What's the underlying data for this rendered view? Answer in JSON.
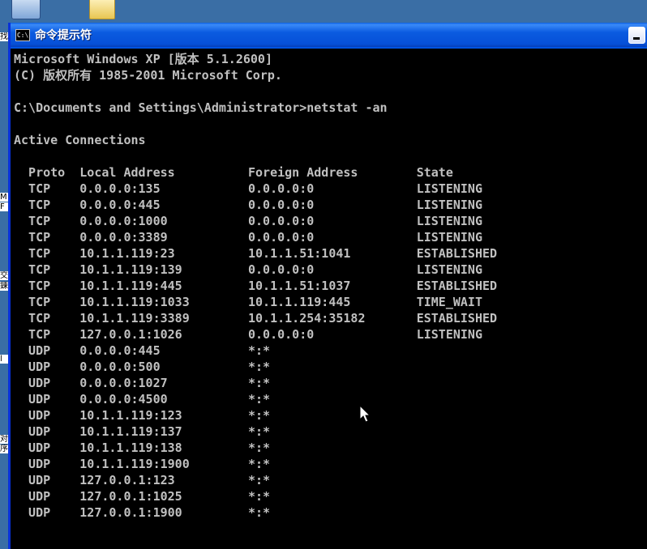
{
  "window": {
    "title": "命令提示符",
    "icon_text": "C:\\"
  },
  "console": {
    "lines": [
      "Microsoft Windows XP [版本 5.1.2600]",
      "(C) 版权所有 1985-2001 Microsoft Corp.",
      "",
      "C:\\Documents and Settings\\Administrator>netstat -an",
      "",
      "Active Connections",
      "",
      "  Proto  Local Address          Foreign Address        State",
      "  TCP    0.0.0.0:135            0.0.0.0:0              LISTENING",
      "  TCP    0.0.0.0:445            0.0.0.0:0              LISTENING",
      "  TCP    0.0.0.0:1000           0.0.0.0:0              LISTENING",
      "  TCP    0.0.0.0:3389           0.0.0.0:0              LISTENING",
      "  TCP    10.1.1.119:23          10.1.1.51:1041         ESTABLISHED",
      "  TCP    10.1.1.119:139         0.0.0.0:0              LISTENING",
      "  TCP    10.1.1.119:445         10.1.1.51:1037         ESTABLISHED",
      "  TCP    10.1.1.119:1033        10.1.1.119:445         TIME_WAIT",
      "  TCP    10.1.1.119:3389        10.1.1.254:35182       ESTABLISHED",
      "  TCP    127.0.0.1:1026         0.0.0.0:0              LISTENING",
      "  UDP    0.0.0.0:445            *:*",
      "  UDP    0.0.0.0:500            *:*",
      "  UDP    0.0.0.0:1027           *:*",
      "  UDP    0.0.0.0:4500           *:*",
      "  UDP    10.1.1.119:123         *:*",
      "  UDP    10.1.1.119:137         *:*",
      "  UDP    10.1.1.119:138         *:*",
      "  UDP    10.1.1.119:1900        *:*",
      "  UDP    127.0.0.1:123          *:*",
      "  UDP    127.0.0.1:1025         *:*",
      "  UDP    127.0.0.1:1900         *:*"
    ]
  },
  "desktop_left_glyphs": [
    "找",
    "M",
    "F",
    "交",
    "鍊",
    "l",
    "对",
    "序"
  ],
  "colors": {
    "console_bg": "#000000",
    "console_fg": "#c0c0c0",
    "title_bar": "#0a5fe0",
    "desktop": "#3a6ea5"
  }
}
